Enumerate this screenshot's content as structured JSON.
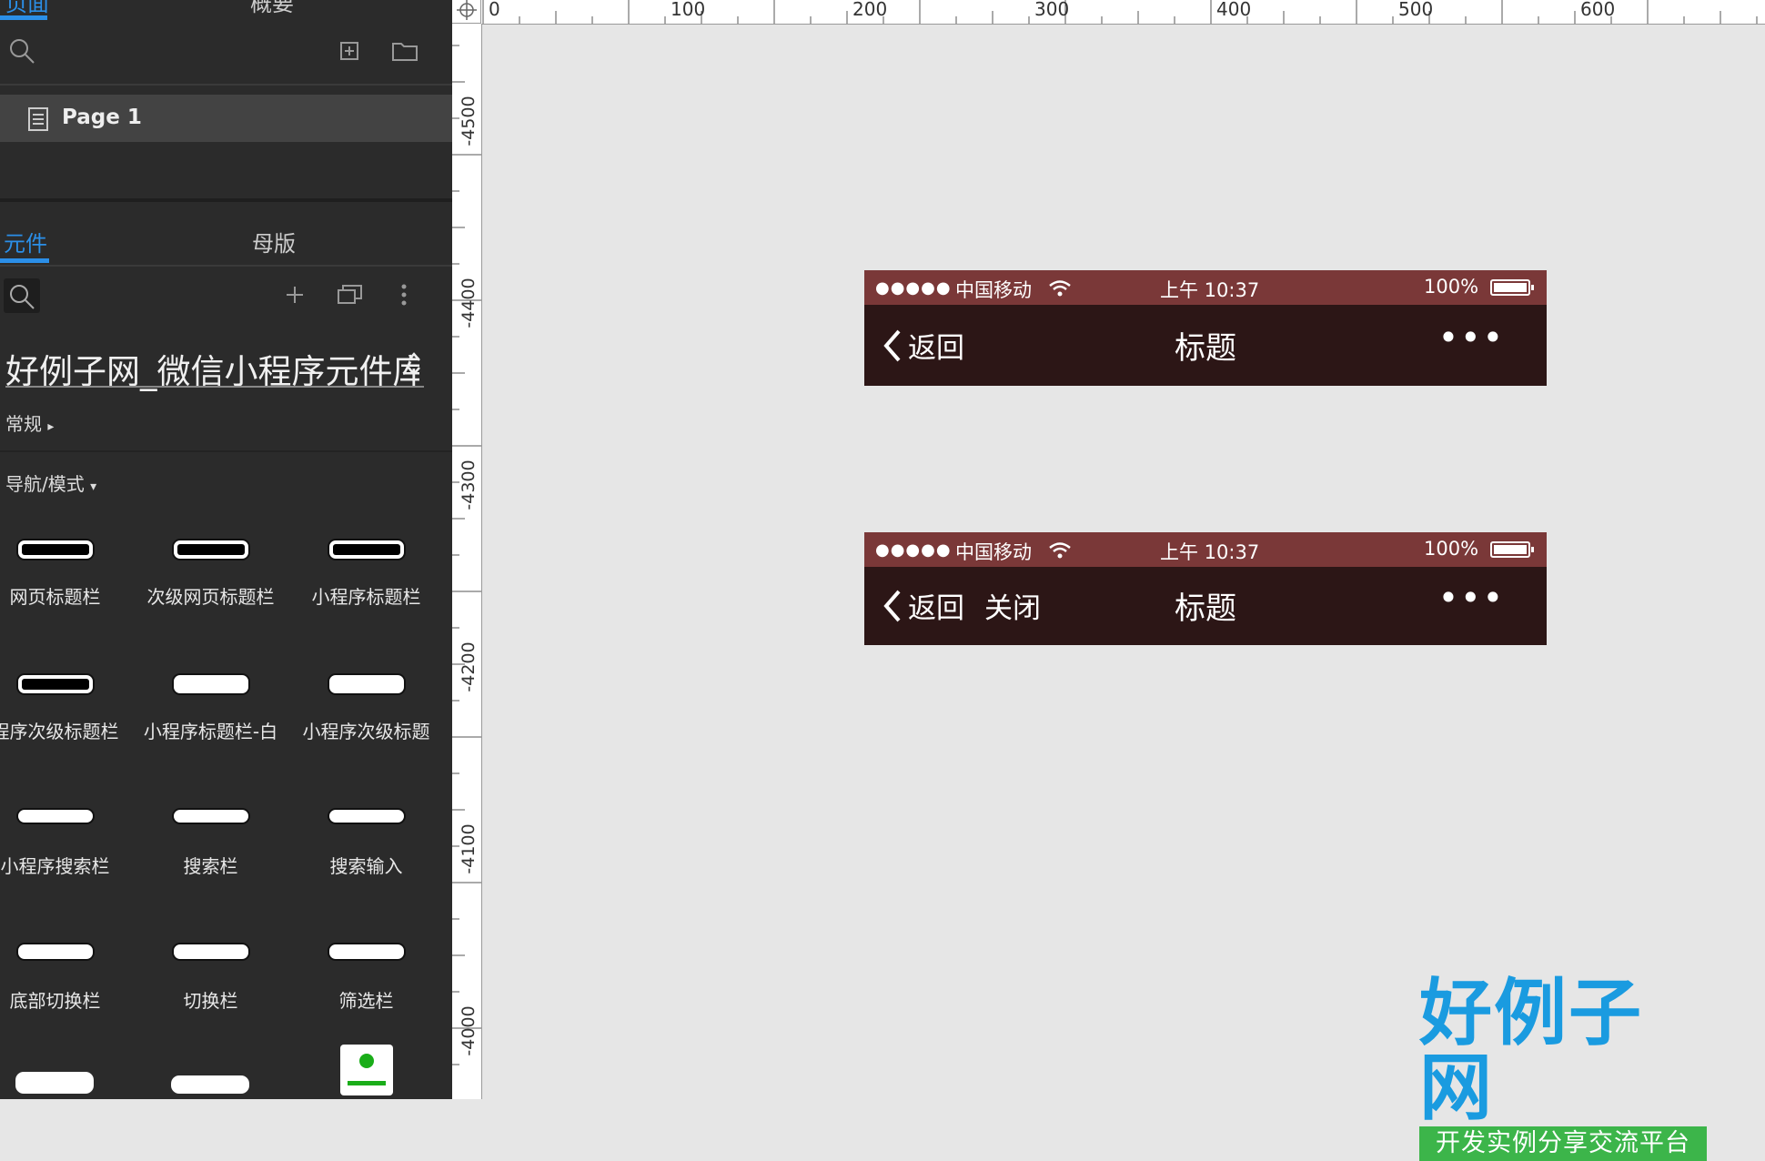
{
  "left": {
    "top_tabs": [
      "页面",
      "概要"
    ],
    "pages": [
      {
        "label": "Page 1"
      }
    ],
    "lower_tabs": [
      "元件",
      "母版"
    ],
    "library_title": "好例子网_微信小程序元件库",
    "sections": [
      {
        "label": "常规",
        "arrow": "▸"
      },
      {
        "label": "导航/模式",
        "arrow": "▾"
      }
    ],
    "components": [
      {
        "name": "网页标题栏",
        "style": "dark"
      },
      {
        "name": "次级网页标题栏",
        "style": "dark"
      },
      {
        "name": "小程序标题栏",
        "style": "dark"
      },
      {
        "name": "程序次级标题栏",
        "style": "dark"
      },
      {
        "name": "小程序标题栏-白",
        "style": "light"
      },
      {
        "name": "小程序次级标题",
        "style": "light"
      },
      {
        "name": "小程序搜索栏",
        "style": "light"
      },
      {
        "name": "搜索栏",
        "style": "light"
      },
      {
        "name": "搜索输入",
        "style": "light"
      },
      {
        "name": "底部切换栏",
        "style": "light"
      },
      {
        "name": "切换栏",
        "style": "light"
      },
      {
        "name": "筛选栏",
        "style": "light"
      }
    ]
  },
  "ruler": {
    "top": [
      "0",
      "100",
      "200",
      "300",
      "400",
      "500",
      "600"
    ],
    "left": [
      "-4500",
      "-4400",
      "-4300",
      "-4200",
      "-4100",
      "-4000"
    ]
  },
  "canvas": {
    "navbars": [
      {
        "signal": "●●●●●",
        "carrier": "中国移动",
        "time": "上午 10:37",
        "battery": "100%",
        "back": "返回",
        "close": "",
        "title": "标题",
        "more": "•••"
      },
      {
        "signal": "●●●●●",
        "carrier": "中国移动",
        "time": "上午 10:37",
        "battery": "100%",
        "back": "返回",
        "close": "关闭",
        "title": "标题",
        "more": "•••"
      }
    ],
    "logo": {
      "main": "好例子网",
      "sub": "开发实例分享交流平台"
    }
  },
  "colors": {
    "accent": "#2b8fe8",
    "status_bar": "#7a3838",
    "nav_bar": "#2c1616",
    "logo_blue": "#1a9be0",
    "logo_green": "#3cb54a"
  }
}
